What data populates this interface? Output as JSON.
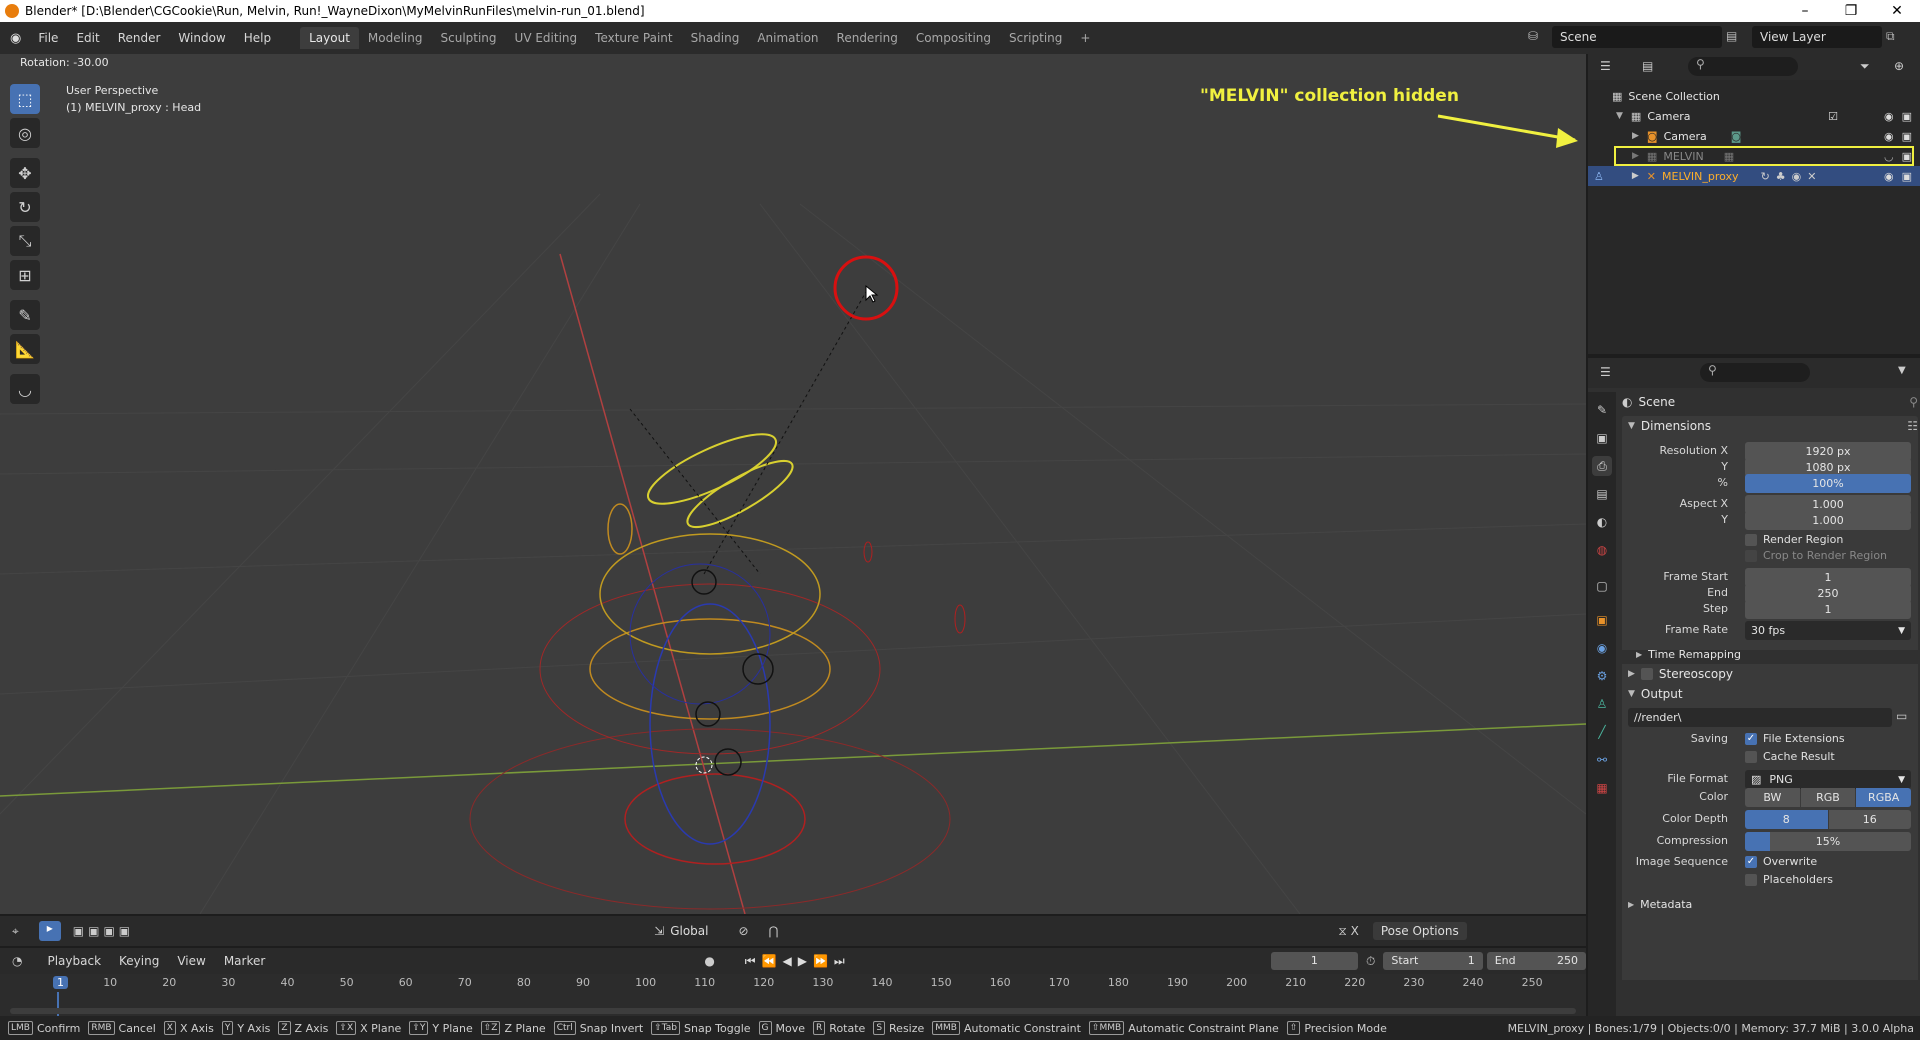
{
  "window": {
    "title": "Blender* [D:\\Blender\\CGCookie\\Run, Melvin, Run!_WayneDixon\\MyMelvinRunFiles\\melvin-run_01.blend]",
    "controls": [
      "–",
      "❐",
      "✕"
    ]
  },
  "menu": [
    "File",
    "Edit",
    "Render",
    "Window",
    "Help"
  ],
  "workspaces": [
    "Layout",
    "Modeling",
    "Sculpting",
    "UV Editing",
    "Texture Paint",
    "Shading",
    "Animation",
    "Rendering",
    "Compositing",
    "Scripting"
  ],
  "active_workspace": "Layout",
  "add_workspace": "+",
  "scene_field": "Scene",
  "view_layer_field": "View Layer",
  "viewport": {
    "operator_info": "Rotation: -30.00",
    "perspective": "User Perspective",
    "active_object": "(1) MELVIN_proxy : Head",
    "annotation": "\"MELVIN\" collection hidden",
    "header": {
      "transform": "Global",
      "mode": "Pose Options"
    }
  },
  "timeline": {
    "menus": [
      "Playback",
      "Keying",
      "View",
      "Marker"
    ],
    "current_frame": "1",
    "start_label": "Start",
    "start": "1",
    "end_label": "End",
    "end": "250",
    "ticks": [
      "1",
      "10",
      "20",
      "30",
      "40",
      "50",
      "60",
      "70",
      "80",
      "90",
      "100",
      "110",
      "120",
      "130",
      "140",
      "150",
      "160",
      "170",
      "180",
      "190",
      "200",
      "210",
      "220",
      "230",
      "240",
      "250"
    ]
  },
  "outliner": {
    "rows": [
      {
        "label": "Scene Collection",
        "indent": 0
      },
      {
        "label": "Camera",
        "indent": 1
      },
      {
        "label": "Camera",
        "indent": 2
      },
      {
        "label": "MELVIN",
        "indent": 2
      },
      {
        "label": "MELVIN_proxy",
        "indent": 2
      }
    ]
  },
  "properties": {
    "context": "Scene",
    "dimensions": {
      "title": "Dimensions",
      "res_x_label": "Resolution X",
      "res_x": "1920 px",
      "res_y_label": "Y",
      "res_y": "1080 px",
      "pct_label": "%",
      "pct": "100%",
      "aspect_x_label": "Aspect X",
      "aspect_x": "1.000",
      "aspect_y_label": "Y",
      "aspect_y": "1.000",
      "render_region": "Render Region",
      "crop": "Crop to Render Region",
      "frame_start_label": "Frame Start",
      "frame_start": "1",
      "end_label": "End",
      "end": "250",
      "step_label": "Step",
      "step": "1",
      "frame_rate_label": "Frame Rate",
      "frame_rate": "30 fps",
      "time_remapping": "Time Remapping"
    },
    "stereoscopy": "Stereoscopy",
    "output": {
      "title": "Output",
      "path": "//render\\",
      "saving_label": "Saving",
      "file_extensions": "File Extensions",
      "cache_result": "Cache Result",
      "file_format_label": "File Format",
      "file_format": "PNG",
      "color_label": "Color",
      "color_options": [
        "BW",
        "RGB",
        "RGBA"
      ],
      "depth_label": "Color Depth",
      "depth_options": [
        "8",
        "16"
      ],
      "compression_label": "Compression",
      "compression": "15%",
      "compression_fraction": 0.15,
      "image_seq_label": "Image Sequence",
      "overwrite": "Overwrite",
      "placeholders": "Placeholders"
    },
    "metadata": "Metadata"
  },
  "statusbar": {
    "items": [
      {
        "key": "LMB",
        "label": "Confirm"
      },
      {
        "key": "RMB",
        "label": "Cancel"
      },
      {
        "key": "X",
        "label": "X Axis"
      },
      {
        "key": "Y",
        "label": "Y Axis"
      },
      {
        "key": "Z",
        "label": "Z Axis"
      },
      {
        "key": "⇧X",
        "label": "X Plane"
      },
      {
        "key": "⇧Y",
        "label": "Y Plane"
      },
      {
        "key": "⇧Z",
        "label": "Z Plane"
      },
      {
        "key": "Ctrl",
        "label": "Snap Invert"
      },
      {
        "key": "⇧Tab",
        "label": "Snap Toggle"
      },
      {
        "key": "G",
        "label": "Move"
      },
      {
        "key": "R",
        "label": "Rotate"
      },
      {
        "key": "S",
        "label": "Resize"
      },
      {
        "key": "MMB",
        "label": "Automatic Constraint"
      },
      {
        "key": "⇧MMB",
        "label": "Automatic Constraint Plane"
      },
      {
        "key": "⇧",
        "label": "Precision Mode"
      }
    ],
    "stats": "MELVIN_proxy | Bones:1/79 | Objects:0/0 | Memory: 37.7 MiB | 3.0.0 Alpha"
  }
}
